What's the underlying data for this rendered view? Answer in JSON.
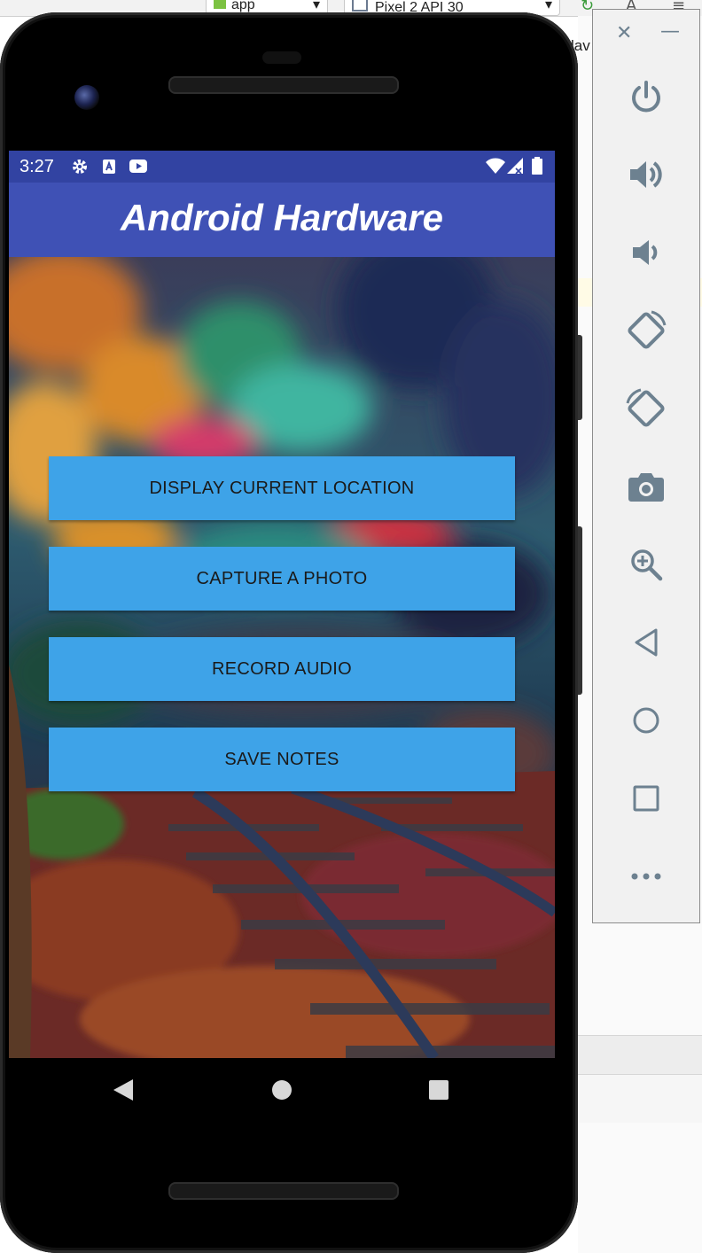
{
  "ide": {
    "run_config": "app",
    "device_name": "Pixel 2 API 30",
    "peek_text": "lav"
  },
  "status_bar": {
    "time": "3:27",
    "icons": [
      "gear-icon",
      "a-notification-icon",
      "youtube-icon",
      "wifi-icon",
      "signal-icon",
      "battery-icon"
    ]
  },
  "app": {
    "title": "Android Hardware",
    "buttons": [
      {
        "label": "DISPLAY CURRENT LOCATION"
      },
      {
        "label": "CAPTURE A PHOTO"
      },
      {
        "label": "RECORD AUDIO"
      },
      {
        "label": "SAVE NOTES"
      }
    ]
  },
  "navigation": {
    "items": [
      "back-icon",
      "home-icon",
      "recents-icon"
    ]
  },
  "emulator_toolbar": {
    "items": [
      "close-icon",
      "minimize-icon",
      "power-icon",
      "volume-up-icon",
      "volume-down-icon",
      "rotate-left-icon",
      "rotate-right-icon",
      "camera-icon",
      "zoom-icon",
      "back-icon",
      "home-icon",
      "overview-icon",
      "more-icon"
    ]
  },
  "colors": {
    "status_bar": "#3243a2",
    "app_bar": "#3f51b5",
    "button": "#3ea3e8",
    "toolbar_icon": "#6d8190"
  }
}
